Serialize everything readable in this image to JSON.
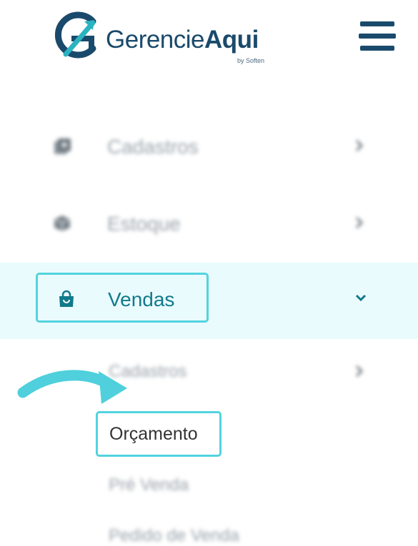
{
  "header": {
    "brand_regular": "Gerencie",
    "brand_bold": "Aqui",
    "brand_sub": "by Soften",
    "menu_icon": "hamburger-icon"
  },
  "colors": {
    "brand": "#1a4a6b",
    "accent": "#52d3de",
    "accent_text": "#117a8b",
    "active_bg": "#eafbfd",
    "muted": "#9aa3ab"
  },
  "menu": {
    "items": [
      {
        "label": "Cadastros",
        "icon": "files-icon",
        "state": "collapsed"
      },
      {
        "label": "Estoque",
        "icon": "box-icon",
        "state": "collapsed"
      },
      {
        "label": "Vendas",
        "icon": "shopping-bag-icon",
        "state": "expanded"
      }
    ],
    "vendas_submenu": [
      {
        "label": "Cadastros",
        "has_children": true
      },
      {
        "label": "Orçamento",
        "highlighted": true
      },
      {
        "label": "Pré Venda"
      },
      {
        "label": "Pedido de Venda"
      }
    ]
  },
  "annotation": {
    "arrow_icon": "curved-arrow-icon"
  }
}
